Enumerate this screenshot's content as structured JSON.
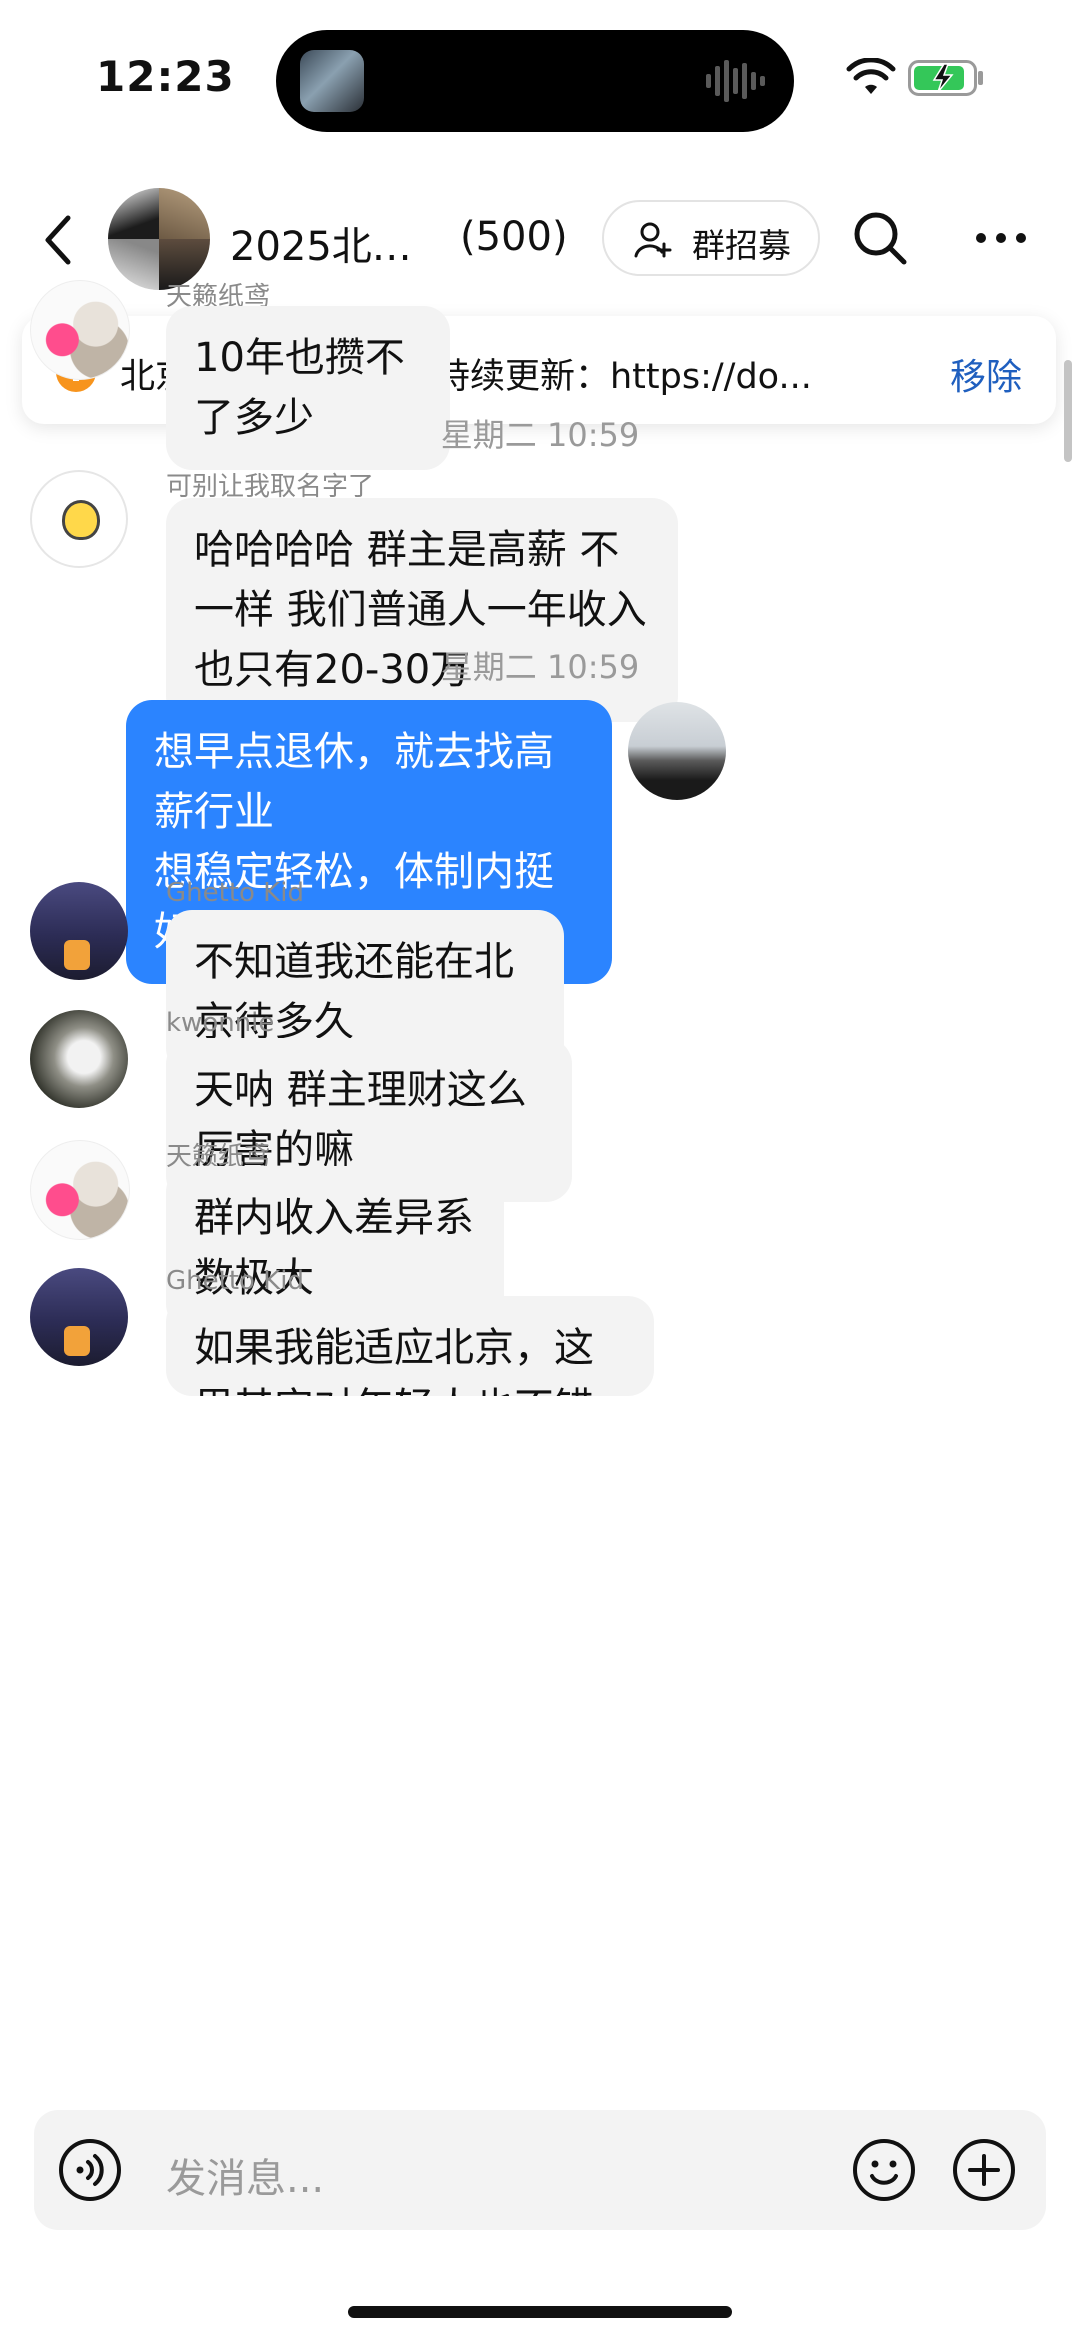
{
  "status_bar": {
    "time": "12:23"
  },
  "header": {
    "group_name": "2025北…",
    "member_count": "(500)",
    "recruit_label": "群招募"
  },
  "pinned": {
    "text": "北京跨年活动汇总，持续更新：https://do...",
    "remove_label": "移除",
    "accent": "#f7941d"
  },
  "messages": [
    {
      "sender": "天籁纸鸢",
      "text": "10年也攒不了多少"
    },
    {
      "time": "星期二 10:59"
    },
    {
      "sender": "可别让我取名字了",
      "text": "哈哈哈哈 群主是高薪 不一样 我们普通人一年收入也只有20-30万"
    },
    {
      "time": "星期二 10:59"
    },
    {
      "sender": "",
      "text": "想早点退休，就去找高薪行业\n想稳定轻松，体制内挺好，就不能退休",
      "mine": true
    },
    {
      "sender": "Ghetto Kid",
      "text": "不知道我还能在北京待多久"
    },
    {
      "sender": "kwonnie",
      "text": "天呐 群主理财这么厉害的嘛"
    },
    {
      "sender": "天籁纸鸢",
      "text": "群内收入差异系数极大"
    },
    {
      "sender": "Ghetto Kid",
      "text": "如果我能适应北京，这里其实对年轻人也不错了"
    }
  ],
  "input": {
    "placeholder": "发消息..."
  },
  "colors": {
    "my_bubble": "#2b84ff",
    "other_bubble": "#f3f3f3",
    "link": "#1f5fbf"
  }
}
